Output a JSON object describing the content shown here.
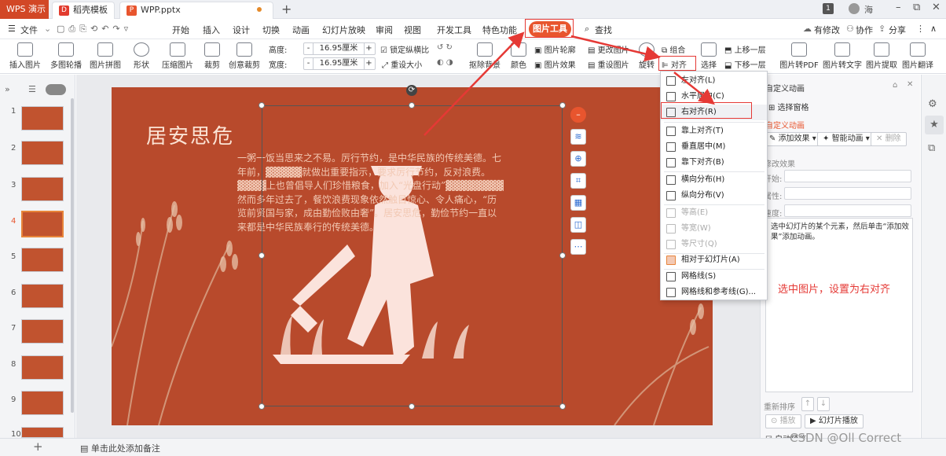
{
  "titlebar": {
    "app_tab": "WPS 演示",
    "tabs": [
      {
        "label": "稻壳模板",
        "icon_text": "D",
        "color": "#e23b2e"
      },
      {
        "label": "WPP.pptx",
        "icon_text": "P",
        "color": "#e8552e"
      }
    ],
    "new_tab_symbol": "+",
    "badge": "1",
    "user": "海",
    "window_controls": [
      "–",
      "⧉",
      "✕"
    ]
  },
  "menubar": {
    "file": "文件",
    "items": [
      "开始",
      "插入",
      "设计",
      "切换",
      "动画",
      "幻灯片放映",
      "审阅",
      "视图",
      "开发工具",
      "特色功能"
    ],
    "active_tab": "图片工具",
    "search": "查找",
    "right_items": [
      "有修改",
      "协作",
      "分享"
    ]
  },
  "ribbon": {
    "buttons": [
      "插入图片",
      "多图轮播",
      "图片拼图",
      "形状",
      "压缩图片",
      "裁剪",
      "创意裁剪"
    ],
    "height_label": "高度:",
    "height_value": "16.95厘米",
    "width_label": "宽度:",
    "width_value": "16.95厘米",
    "lock_ratio": "锁定纵横比",
    "reset_size": "重设大小",
    "remove_bg": "抠除背景",
    "color": "颜色",
    "img_border": "图片轮廓",
    "img_effect": "图片效果",
    "change_img": "更改图片",
    "reset_img": "重设图片",
    "rotate": "旋转",
    "group": "组合",
    "align": "对齐",
    "select": "选择",
    "bring_forward": "上移一层",
    "send_backward": "下移一层",
    "to_pdf": "图片转PDF",
    "to_text": "图片转文字",
    "extract": "图片提取",
    "translate": "图片翻译"
  },
  "thumbnails": {
    "numbers": [
      "1",
      "2",
      "3",
      "4",
      "5",
      "6",
      "7",
      "8",
      "9",
      "10"
    ],
    "selected": "4"
  },
  "slide": {
    "title": "居安思危",
    "body": "一粥一饭当思来之不易。厉行节约，是中华民族的传统美德。七年前，▓▓▓▓▓就做出重要指示，要求厉行节约，反对浪费。▓▓▓▓上也曾倡导人们珍惜粮食，加入“光盘行动”▓▓▓▓▓▓▓▓然而多年过去了，餐饮浪费现象依然触目惊心、令人痛心，“历览前贤国与家，成由勤俭败由奢”。居安思危，勤俭节约一直以来都是中华民族奉行的传统美德。",
    "bg_color": "#b84a2c"
  },
  "float_tools": [
    "–",
    "≋",
    "⊕",
    "⌗",
    "▦",
    "◫",
    "⋯"
  ],
  "dropdown": {
    "items": [
      {
        "label": "左对齐(L)",
        "enabled": true
      },
      {
        "label": "水平居中(C)",
        "enabled": true
      },
      {
        "label": "右对齐(R)",
        "enabled": true
      },
      {
        "label": "靠上对齐(T)",
        "enabled": true
      },
      {
        "label": "垂直居中(M)",
        "enabled": true
      },
      {
        "label": "靠下对齐(B)",
        "enabled": true
      },
      {
        "label": "横向分布(H)",
        "enabled": true
      },
      {
        "label": "纵向分布(V)",
        "enabled": true
      },
      {
        "label": "等高(E)",
        "enabled": false
      },
      {
        "label": "等宽(W)",
        "enabled": false
      },
      {
        "label": "等尺寸(Q)",
        "enabled": false
      },
      {
        "label": "相对于幻灯片(A)",
        "enabled": true
      },
      {
        "label": "网格线(S)",
        "enabled": true
      },
      {
        "label": "网格线和参考线(G)...",
        "enabled": true
      }
    ]
  },
  "rightpanel": {
    "header": "自定义动画",
    "select_pane": "选择窗格",
    "section": "自定义动画",
    "add_effect": "添加效果",
    "smart_anim": "智能动画",
    "delete": "删除",
    "modify": "修改效果",
    "start": "开始:",
    "prop": "属性:",
    "speed": "速度:",
    "hint": "选中幻灯片的某个元素，然后单击“添加效果”添加动画。",
    "reorder": "重新排序",
    "play": "播放",
    "slideshow": "幻灯片播放",
    "auto_preview": "自动预览"
  },
  "statusbar": {
    "notes": "单击此处添加备注"
  },
  "annotation": "选中图片，设置为右对齐",
  "watermark": "CSDN @Oll Correct",
  "colors": {
    "accent": "#e8552e",
    "annotation_red": "#e53935"
  }
}
